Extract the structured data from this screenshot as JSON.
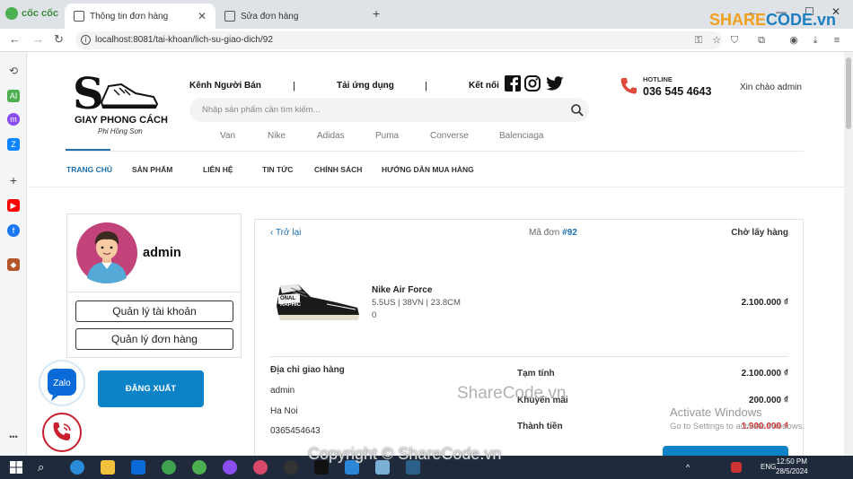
{
  "browser": {
    "brand": "cốc cốc",
    "tabs": [
      {
        "label": "Thông tin đơn hàng",
        "active": true
      },
      {
        "label": "Sửa đơn hàng",
        "active": false
      }
    ],
    "url": "localhost:8081/tai-khoan/lich-su-giao-dich/92"
  },
  "header": {
    "logo_line1": "GIAY PHONG CÁCH",
    "logo_line2": "Phi Hồng Sơn",
    "links": [
      "Kênh Người Bán",
      "Tải ứng dụng",
      "Kết nối"
    ],
    "separator": "|",
    "search_placeholder": "Nhập sản phẩm cần tìm kiếm...",
    "brands": [
      "Van",
      "Nike",
      "Adidas",
      "Puma",
      "Converse",
      "Balenciaga"
    ],
    "hotline_label": "HOTLINE",
    "hotline_number": "036 545 4643",
    "greeting": "Xin chào admin"
  },
  "menu": [
    "TRANG CHỦ",
    "SẢN PHẨM",
    "LIÊN HỆ",
    "TIN TỨC",
    "CHÍNH SÁCH",
    "HƯỚNG DẪN MUA HÀNG"
  ],
  "profile": {
    "name": "admin",
    "manage_account": "Quản lý tài khoản",
    "manage_orders": "Quản lý đơn hàng",
    "logout": "ĐĂNG XUẤT"
  },
  "order": {
    "back": "Trở lại",
    "order_label": "Mã đơn",
    "order_id": "#92",
    "status": "Chờ lấy hàng",
    "product": {
      "name": "Nike Air Force",
      "variant": "5.5US | 38VN | 23.8CM",
      "qty": "0",
      "price": "2.100.000 ₫"
    },
    "shipping_title": "Địa chỉ giao hàng",
    "shipping_name": "admin",
    "shipping_city": "Ha Noi",
    "shipping_phone": "0365454643",
    "subtotal_label": "Tạm tính",
    "subtotal": "2.100.000 ₫",
    "discount_label": "Khuyến mãi",
    "discount": "200.000 ₫",
    "total_label": "Thành tiền",
    "total": "1.900.000 ₫"
  },
  "watermarks": {
    "logo": "SHARE",
    "logo2": "CODE.vn",
    "mid": "ShareCode.vn",
    "bottom": "Copyright © ShareCode.vn",
    "activate": "Activate Windows",
    "activate_sub": "Go to Settings to activate Windows."
  },
  "taskbar": {
    "lang": "ENG",
    "time": "12:50 PM",
    "date": "28/5/2024"
  }
}
